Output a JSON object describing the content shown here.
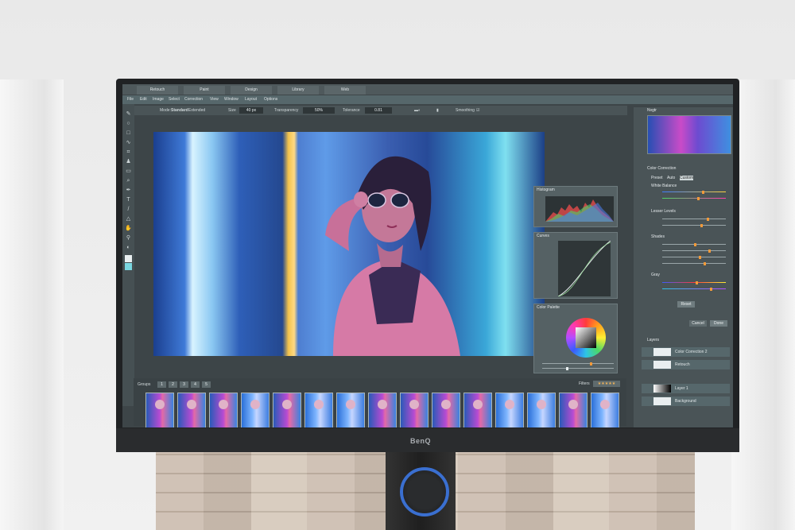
{
  "app": {
    "tabs": [
      "Retouch",
      "Paint",
      "Design",
      "Library",
      "Web"
    ],
    "menu": [
      "File",
      "Edit",
      "Image",
      "Select",
      "Correction",
      "View",
      "Window",
      "Layout",
      "Options"
    ],
    "options": {
      "mode_label": "Mode:",
      "mode_standard": "Standard",
      "mode_extended": "Extended",
      "size_label": "Size",
      "size_value": "40 px",
      "transparency_label": "Transparency",
      "transparency_value": "50%",
      "tolerance_label": "Tolerance",
      "tolerance_value": "0.81",
      "smoothing_label": "Smoothing"
    },
    "panels": {
      "histogram_title": "Histogram",
      "curves_title": "Curves",
      "color_palette_title": "Color Palette"
    },
    "right": {
      "navigator_title": "Nvgtr",
      "color_correction_title": "Color Correction",
      "tabs": [
        "Preset",
        "Auto",
        "Custom"
      ],
      "groups": [
        "White Balance",
        "Lesser Levels",
        "Shades",
        "Gray"
      ],
      "reset_label": "Reset",
      "cancel_label": "Cancel",
      "done_label": "Done",
      "layers_title": "Layers",
      "layers": [
        "Color Correction 2",
        "Retouch",
        "Layer 1",
        "Background"
      ]
    },
    "filmstrip": {
      "groups_label": "Groups",
      "group_buttons": [
        "1",
        "2",
        "3",
        "4",
        "5"
      ],
      "filters_label": "Filters",
      "rating": "★★★★★"
    }
  },
  "device": {
    "brand": "BenQ",
    "accent_ring": "#3a6fd0"
  }
}
